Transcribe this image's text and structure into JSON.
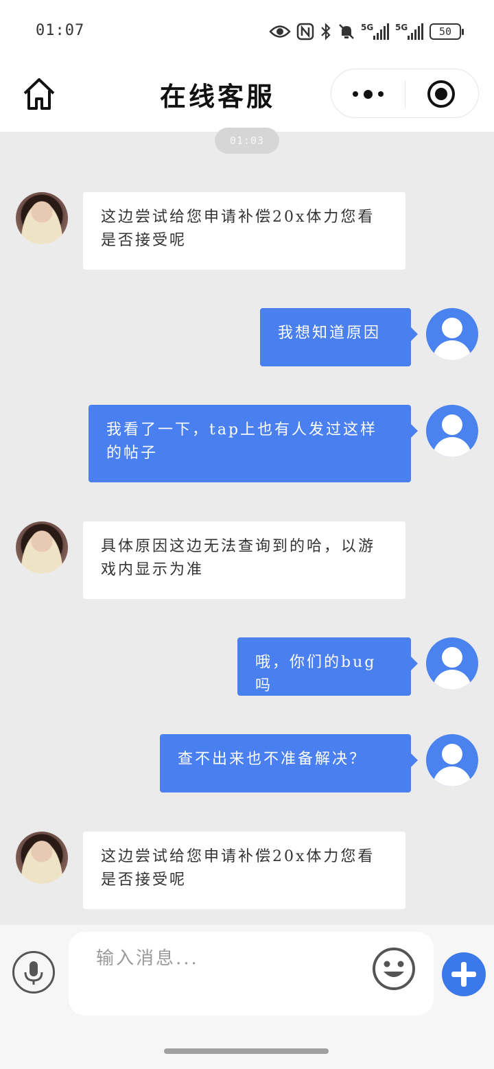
{
  "status_bar": {
    "time": "01:07",
    "battery": "50",
    "icons": [
      "eye-icon",
      "nfc-icon",
      "bluetooth-icon",
      "mute-icon",
      "signal-5g-icon",
      "signal-5g-icon",
      "battery-icon"
    ]
  },
  "nav": {
    "title": "在线客服",
    "home_icon": "home-icon",
    "more_icon": "more-dots-icon",
    "close_icon": "record-close-icon"
  },
  "chat": {
    "time_divider": "01:03",
    "messages": [
      {
        "sender": "agent",
        "text": "这边尝试给您申请补偿20x体力您看是否接受呢"
      },
      {
        "sender": "user",
        "text": "我想知道原因"
      },
      {
        "sender": "user",
        "text": "我看了一下，tap上也有人发过这样的帖子"
      },
      {
        "sender": "agent",
        "text": "具体原因这边无法查询到的哈，以游戏内显示为准"
      },
      {
        "sender": "user",
        "text": "哦，你们的bug吗"
      },
      {
        "sender": "user",
        "text": "查不出来也不准备解决？"
      },
      {
        "sender": "agent",
        "text": "这边尝试给您申请补偿20x体力您看是否接受呢"
      }
    ]
  },
  "input_bar": {
    "placeholder": "输入消息...",
    "mic_icon": "microphone-icon",
    "emoji_icon": "emoji-icon",
    "plus_icon": "plus-icon"
  },
  "colors": {
    "user_bubble": "#4a7ff0",
    "chat_background": "#ebebeb",
    "plus_button": "#3b78ea"
  }
}
